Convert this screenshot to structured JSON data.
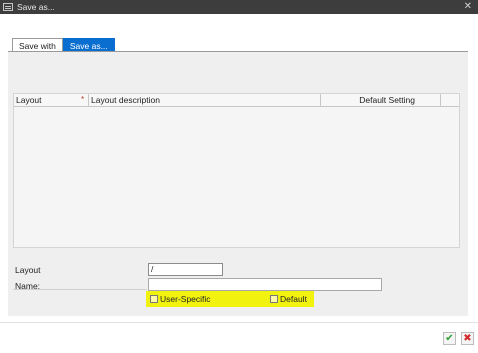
{
  "window": {
    "title": "Save as..."
  },
  "tabs": [
    {
      "label": "Save with"
    },
    {
      "label": "Save as..."
    }
  ],
  "table": {
    "columns": [
      "Layout",
      "Layout description",
      "Default Setting"
    ]
  },
  "form": {
    "layout_label": "Layout",
    "layout_value": "/",
    "name_label": "Name:",
    "name_value": "",
    "user_specific_label": "User-Specific",
    "default_label": "Default"
  },
  "colors": {
    "titlebar": "#3d3d3d",
    "active_tab": "#0a6ed1",
    "highlight": "#f2f20f",
    "ok": "#2e9c2e",
    "cancel": "#d12a2a"
  },
  "icons": {
    "window": "window-icon",
    "close": "close-icon",
    "ok": "checkmark-icon",
    "cancel": "x-icon"
  }
}
